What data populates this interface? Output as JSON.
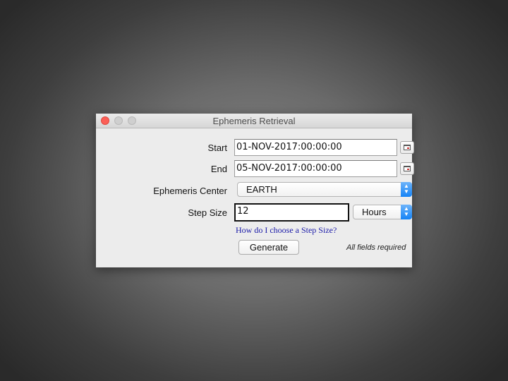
{
  "window": {
    "title": "Ephemeris Retrieval"
  },
  "form": {
    "start": {
      "label": "Start",
      "value": "01-NOV-2017:00:00:00"
    },
    "end": {
      "label": "End",
      "value": "05-NOV-2017:00:00:00"
    },
    "ephemeris_center": {
      "label": "Ephemeris Center",
      "selected": "EARTH"
    },
    "step_size": {
      "label": "Step Size",
      "value": "12",
      "unit_selected": "Hours",
      "help_link": "How do I choose a Step Size?"
    },
    "generate_label": "Generate",
    "required_note": "All fields required"
  },
  "icons": {
    "calendar": "calendar-icon",
    "select_arrows": "updown-chevron-icon"
  },
  "colors": {
    "close_button": "#fc5f57",
    "select_accent": "#1583f6",
    "link": "#1a1aa8"
  }
}
